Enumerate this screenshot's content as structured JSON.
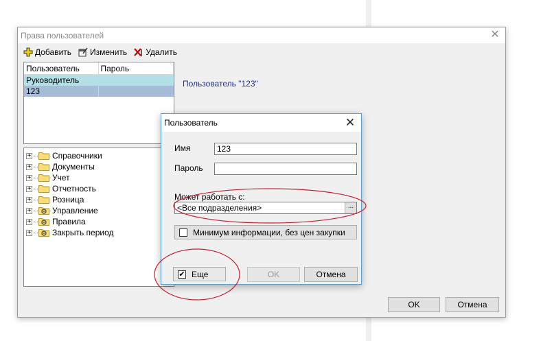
{
  "window": {
    "title": "Права пользователей",
    "close_glyph": "✕",
    "toolbar": {
      "add_label": "Добавить",
      "edit_label": "Изменить",
      "delete_label": "Удалить"
    },
    "users_table": {
      "columns": [
        "Пользователь",
        "Пароль"
      ],
      "rows": [
        {
          "user": "Руководитель",
          "password": ""
        },
        {
          "user": "123",
          "password": ""
        }
      ]
    },
    "tree": [
      {
        "label": "Справочники",
        "icon": "folder-icon"
      },
      {
        "label": "Документы",
        "icon": "folder-icon"
      },
      {
        "label": "Учет",
        "icon": "folder-icon"
      },
      {
        "label": "Отчетность",
        "icon": "folder-icon"
      },
      {
        "label": "Розница",
        "icon": "folder-icon"
      },
      {
        "label": "Управление",
        "icon": "gear-folder-icon"
      },
      {
        "label": "Правила",
        "icon": "gear-folder-icon"
      },
      {
        "label": "Закрыть период",
        "icon": "gear-folder-icon"
      }
    ],
    "user_caption": "Пользователь \"123\"",
    "ok_label": "OK",
    "cancel_label": "Отмена"
  },
  "dialog": {
    "title": "Пользователь",
    "close_glyph": "✕",
    "name_label": "Имя",
    "name_value": "123",
    "password_label": "Пароль",
    "password_value": "",
    "works_with_label": "Может работать с:",
    "works_with_value": "<Все подразделения>",
    "ellipsis": "...",
    "min_info_label": "Минимум информации, без цен закупки",
    "min_info_checked": false,
    "more_label": "Еще",
    "more_checked": true,
    "ok_label": "OK",
    "cancel_label": "Отмена"
  },
  "colors": {
    "selected_row_1": "#b2e0e6",
    "selected_row_2": "#a6bcd8",
    "caption_text": "#1f2d8a",
    "annotation_ellipse": "#c8202a",
    "dialog_border": "#5a9fd4"
  }
}
